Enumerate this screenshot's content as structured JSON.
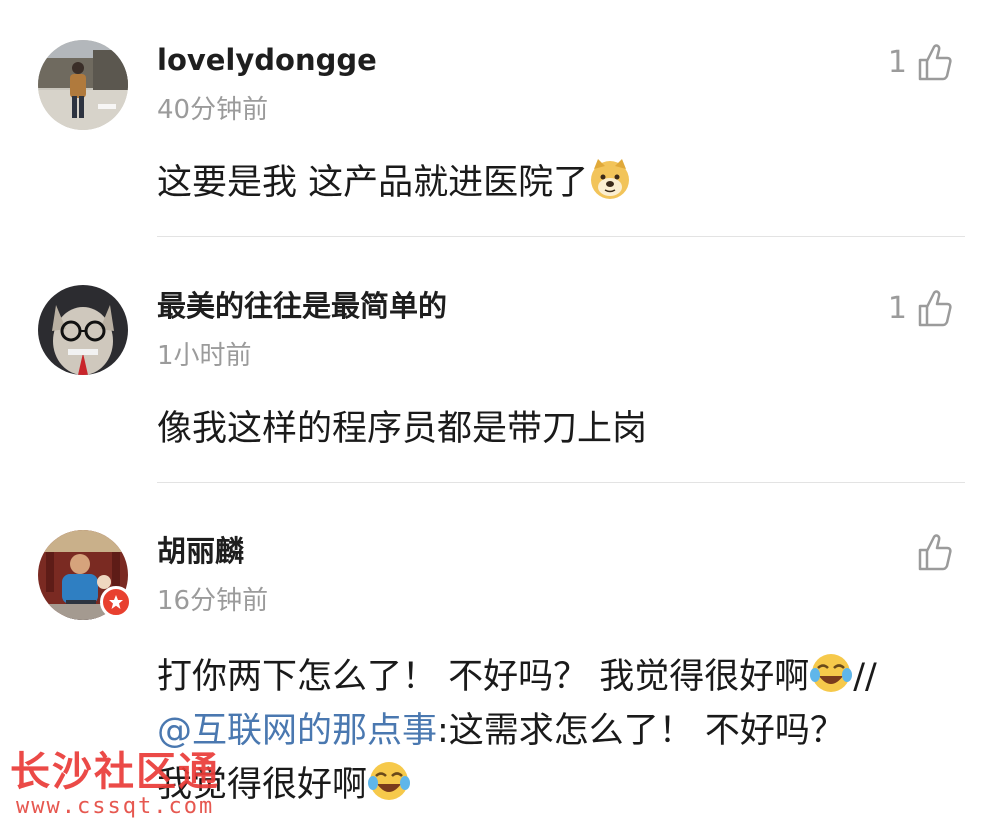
{
  "comments": [
    {
      "username": "lovelydongge",
      "time": "40分钟前",
      "likes": "1",
      "text": "这要是我 这产品就进医院了",
      "emoji": "doge-emoji"
    },
    {
      "username": "最美的往往是最简单的",
      "time": "1小时前",
      "likes": "1",
      "text": "像我这样的程序员都是带刀上岗"
    },
    {
      "username": "胡丽麟",
      "time": "16分钟前",
      "likes": "",
      "verified": true,
      "text_part1": "打你两下怎么了！ 不好吗？ 我觉得很好啊",
      "text_part2": "//",
      "mention": "@互联网的那点事",
      "text_part3": ":这需求怎么了！ 不好吗？",
      "text_part4": "我觉得很好啊",
      "emoji": "laughing-crying-emoji"
    }
  ],
  "watermark": {
    "title": "长沙社区通",
    "url": "www.cssqt.com"
  },
  "colors": {
    "mention": "#4a78b0",
    "muted": "#9b9b9b",
    "divider": "#e3e3e3",
    "badge": "#e8402f",
    "watermark": "#ea3b38"
  },
  "icons": {
    "like": "thumbs-up-icon",
    "verified": "star-badge-icon"
  }
}
